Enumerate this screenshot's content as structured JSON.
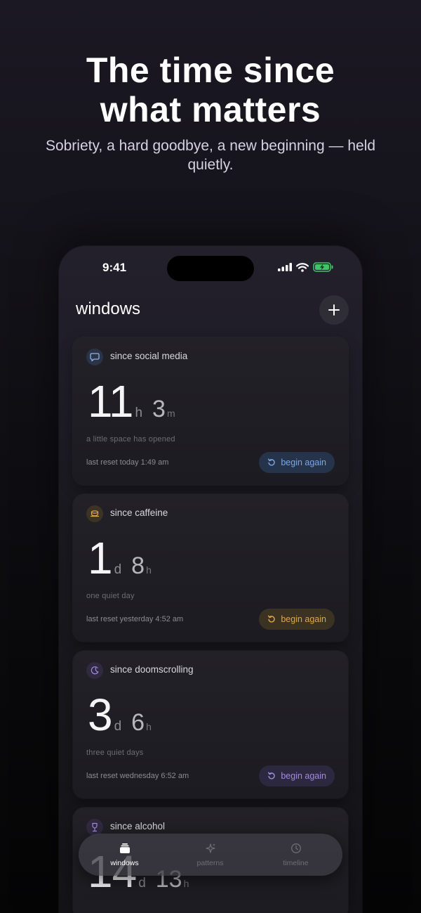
{
  "hero": {
    "title_line1": "The time since",
    "title_line2": "what matters",
    "subtitle": "Sobriety, a hard goodbye, a new beginning — held quietly."
  },
  "status_bar": {
    "time": "9:41"
  },
  "app": {
    "title": "windows",
    "add_icon": "plus-icon"
  },
  "cards": [
    {
      "label": "since social media",
      "icon": "chat-bubble-icon",
      "big": "11",
      "big_unit": "h",
      "small": "3",
      "small_unit": "m",
      "tagline": "a little space has opened",
      "last_reset": "last reset today 1:49 am",
      "button": "begin again",
      "accent": "#7aa6e6"
    },
    {
      "label": "since caffeine",
      "icon": "coffee-cup-icon",
      "big": "1",
      "big_unit": "d",
      "small": "8",
      "small_unit": "h",
      "tagline": "one quiet day",
      "last_reset": "last reset yesterday 4:52 am",
      "button": "begin again",
      "accent": "#e0a64a"
    },
    {
      "label": "since doomscrolling",
      "icon": "moon-icon",
      "big": "3",
      "big_unit": "d",
      "small": "6",
      "small_unit": "h",
      "tagline": "three quiet days",
      "last_reset": "last reset wednesday 6:52 am",
      "button": "begin again",
      "accent": "#a08cde"
    },
    {
      "label": "since alcohol",
      "icon": "wine-glass-icon",
      "big": "14",
      "big_unit": "d",
      "small": "13",
      "small_unit": "h",
      "accent": "#a08cde"
    }
  ],
  "tabs": [
    {
      "label": "windows",
      "icon": "stack-icon",
      "active": true
    },
    {
      "label": "patterns",
      "icon": "sparkle-icon",
      "active": false
    },
    {
      "label": "timeline",
      "icon": "clock-icon",
      "active": false
    }
  ]
}
